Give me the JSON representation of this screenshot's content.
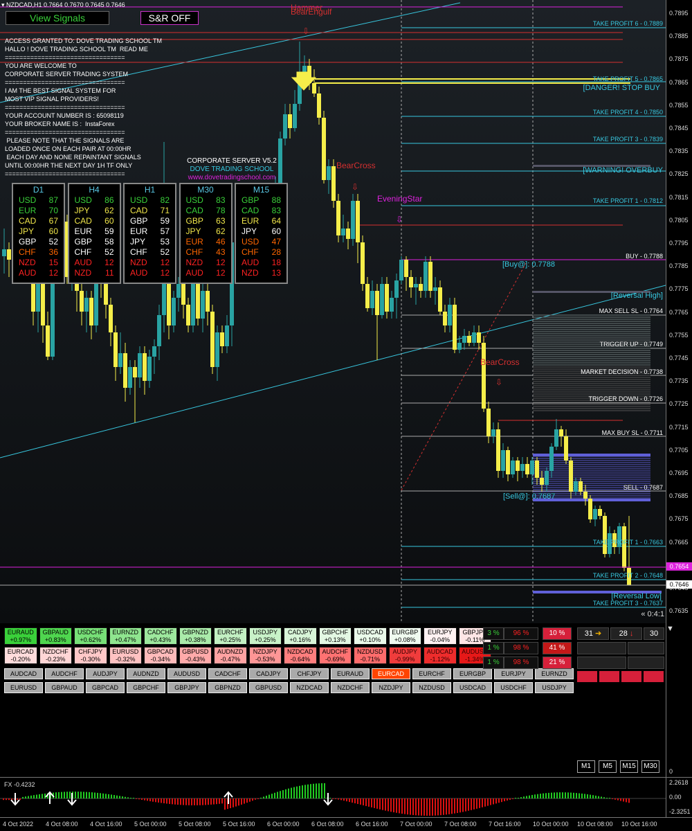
{
  "header": {
    "symbol_info": "NZDCAD,H1  0.7664 0.7670 0.7645 0.7646",
    "view_signals_label": "View Signals",
    "sr_label": "S&R OFF"
  },
  "messages": [
    "ACCESS GRANTED TO: DOVE TRADING SCHOOL TM",
    "HALLO ! DOVE TRADING SCHOOL TM  READ ME",
    "=================================",
    "YOU ARE WELCOME TO",
    "CORPORATE SERVER TRADING SYSTEM",
    "=================================",
    "I AM THE BEST SIGNAL SYSTEM FOR",
    "MOST VIP SIGNAL PROVIDERS!",
    "=================================",
    "YOUR ACCOUNT NUMBER IS : 65098119",
    "YOUR BROKER NAME IS :  InstaForex",
    "=================================",
    " PLEASE NOTE THAT THE SIGNALS ARE",
    "LOADED ONCE ON EACH PAIR AT 00:00HR",
    " EACH DAY AND NONE REPAINTANT SIGNALS",
    "UNTIL 00:00HR THE NEXT DAY 1H TF ONLY",
    "================================="
  ],
  "server": {
    "line1": "CORPORATE SERVER V5.2",
    "line2": "DOVE TRADING SCHOOL",
    "line3": "www.dovetradingschool.com"
  },
  "strength_panels": [
    {
      "title": "D1",
      "rows": [
        [
          "USD",
          "87",
          "#3ad13a"
        ],
        [
          "EUR",
          "70",
          "#3ad13a"
        ],
        [
          "CAD",
          "67",
          "#f0e64a"
        ],
        [
          "JPY",
          "60",
          "#f0e64a"
        ],
        [
          "GBP",
          "52",
          "#ffffff"
        ],
        [
          "CHF",
          "36",
          "#ff6600"
        ],
        [
          "NZD",
          "15",
          "#ff2222"
        ],
        [
          "AUD",
          "12",
          "#ff2222"
        ]
      ]
    },
    {
      "title": "H4",
      "rows": [
        [
          "USD",
          "86",
          "#3ad13a"
        ],
        [
          "JPY",
          "62",
          "#f0e64a"
        ],
        [
          "CAD",
          "60",
          "#f0e64a"
        ],
        [
          "EUR",
          "59",
          "#ffffff"
        ],
        [
          "GBP",
          "58",
          "#ffffff"
        ],
        [
          "CHF",
          "52",
          "#ffffff"
        ],
        [
          "AUD",
          "12",
          "#ff2222"
        ],
        [
          "NZD",
          "11",
          "#ff2222"
        ]
      ]
    },
    {
      "title": "H1",
      "rows": [
        [
          "USD",
          "82",
          "#3ad13a"
        ],
        [
          "CAD",
          "71",
          "#f0e64a"
        ],
        [
          "GBP",
          "59",
          "#ffffff"
        ],
        [
          "EUR",
          "57",
          "#ffffff"
        ],
        [
          "JPY",
          "53",
          "#ffffff"
        ],
        [
          "CHF",
          "52",
          "#ffffff"
        ],
        [
          "NZD",
          "12",
          "#ff2222"
        ],
        [
          "AUD",
          "12",
          "#ff2222"
        ]
      ]
    },
    {
      "title": "M30",
      "rows": [
        [
          "USD",
          "83",
          "#3ad13a"
        ],
        [
          "CAD",
          "78",
          "#3ad13a"
        ],
        [
          "GBP",
          "63",
          "#f0e64a"
        ],
        [
          "JPY",
          "62",
          "#f0e64a"
        ],
        [
          "EUR",
          "46",
          "#ff6600"
        ],
        [
          "CHF",
          "43",
          "#ff6600"
        ],
        [
          "NZD",
          "12",
          "#ff2222"
        ],
        [
          "AUD",
          "12",
          "#ff2222"
        ]
      ]
    },
    {
      "title": "M15",
      "rows": [
        [
          "GBP",
          "88",
          "#3ad13a"
        ],
        [
          "CAD",
          "83",
          "#3ad13a"
        ],
        [
          "EUR",
          "64",
          "#f0e64a"
        ],
        [
          "JPY",
          "60",
          "#ffffff"
        ],
        [
          "USD",
          "47",
          "#ff6600"
        ],
        [
          "CHF",
          "28",
          "#ff6600"
        ],
        [
          "AUD",
          "18",
          "#ff2222"
        ],
        [
          "NZD",
          "13",
          "#ff2222"
        ]
      ]
    }
  ],
  "patterns": {
    "hammer": "Hammer",
    "bearish_engulf": "BearEngulf",
    "bearcross1": "BearCross",
    "eveningstar": "EveningStar",
    "bearcross2": "BearCross"
  },
  "levels": {
    "tp6": "TAKE PROFIT 6  -  0.7889",
    "tp5": "TAKE PROFIT 5  -  0.7865",
    "danger": "[DANGER! STOP BUY",
    "tp4": "TAKE PROFIT 4  -  0.7850",
    "tp3": "TAKE PROFIT 3  -  0.7839",
    "warning": "[WARNING! OVERBUY",
    "tp1": "TAKE PROFIT 1  -  0.7812",
    "buy": "BUY  -  0.7788",
    "buy_at": "[Buy@]: 0.7788",
    "rev_high": "[Reversal High]",
    "max_sell_sl": "MAX SELL SL  -  0.7764",
    "trigger_up": "TRIGGER UP  -  0.7749",
    "market_decision": "MARKET DECISION  -  0.7738",
    "trigger_down": "TRIGGER DOWN  -  0.7726",
    "max_buy_sl": "MAX BUY SL  -  0.7711",
    "sell": "SELL  -  0.7687",
    "sell_at": "[Sell@]: 0.7687",
    "stp1": "TAKE PROFIT 1  -  0.7663",
    "stp2": "TAKE PROFIT 2  -  0.7648",
    "rev_low": "[Reversal Low]",
    "stp3": "TAKE PROFIT 3  -  0.7637",
    "countdown": "« 0:4:1"
  },
  "price_axis": [
    "0.7895",
    "0.7885",
    "0.7875",
    "0.7865",
    "0.7855",
    "0.7845",
    "0.7835",
    "0.7825",
    "0.7815",
    "0.7805",
    "0.7795",
    "0.7785",
    "0.7775",
    "0.7765",
    "0.7755",
    "0.7745",
    "0.7735",
    "0.7725",
    "0.7715",
    "0.7705",
    "0.7695",
    "0.7685",
    "0.7675",
    "0.7665",
    "0.7655",
    "0.7645",
    "0.7635"
  ],
  "price_tags": {
    "tag1": "0.7654",
    "tag2": "0.7646"
  },
  "tiles": [
    [
      "EURAUD",
      "+0.97%",
      "#3ad13a"
    ],
    [
      "GBPAUD",
      "+0.83%",
      "#4fd64f"
    ],
    [
      "USDCHF",
      "+0.62%",
      "#77e077"
    ],
    [
      "EURNZD",
      "+0.47%",
      "#8fe58f"
    ],
    [
      "CADCHF",
      "+0.43%",
      "#9de89d"
    ],
    [
      "GBPNZD",
      "+0.38%",
      "#aaebaa"
    ],
    [
      "EURCHF",
      "+0.25%",
      "#c2f0c2"
    ],
    [
      "USDJPY",
      "+0.25%",
      "#c8f2c8"
    ],
    [
      "CADJPY",
      "+0.16%",
      "#d8f5d8"
    ],
    [
      "GBPCHF",
      "+0.13%",
      "#e3f8e3"
    ],
    [
      "USDCAD",
      "+0.10%",
      "#eafaea"
    ],
    [
      "EURGBP",
      "+0.08%",
      "#f0fbf0"
    ],
    [
      "EURJPY",
      "-0.04%",
      "#fff2f2"
    ],
    [
      "GBPJPY",
      "-0.11%",
      "#ffe6e6"
    ],
    [
      "EURCAD",
      "-0.20%",
      "#ffdcdc"
    ],
    [
      "NZDCHF",
      "-0.23%",
      "#ffd6d6"
    ],
    [
      "CHFJPY",
      "-0.30%",
      "#ffc8c8"
    ],
    [
      "EURUSD",
      "-0.32%",
      "#ffc2c2"
    ],
    [
      "GBPCAD",
      "-0.34%",
      "#ffbbbb"
    ],
    [
      "GBPUSD",
      "-0.43%",
      "#ffaaaa"
    ],
    [
      "AUDNZD",
      "-0.47%",
      "#ffa2a2"
    ],
    [
      "NZDJPY",
      "-0.53%",
      "#ff9696"
    ],
    [
      "NZDCAD",
      "-0.64%",
      "#ff7e7e"
    ],
    [
      "AUDCHF",
      "-0.69%",
      "#ff7272"
    ],
    [
      "NZDUSD",
      "-0.71%",
      "#ff6c6c"
    ],
    [
      "AUDJPY",
      "-0.99%",
      "#f03c3c"
    ],
    [
      "AUDCAD",
      "-1.12%",
      "#ee2c2c"
    ],
    [
      "AUDUSD",
      "-1.34%",
      "#e61818"
    ]
  ],
  "pair_buttons_row1": [
    "AUDCAD",
    "AUDCHF",
    "AUDJPY",
    "AUDNZD",
    "AUDUSD",
    "CADCHF",
    "CADJPY",
    "CHFJPY",
    "EURAUD",
    "EURCAD",
    "EURCHF",
    "EURGBP",
    "EURJPY",
    "EURNZD"
  ],
  "pair_buttons_row2": [
    "EURUSD",
    "GBPAUD",
    "GBPCAD",
    "GBPCHF",
    "GBPJPY",
    "GBPNZD",
    "GBPUSD",
    "NZDCAD",
    "NZDCHF",
    "NZDJPY",
    "NZDUSD",
    "USDCAD",
    "USDCHF",
    "USDJPY"
  ],
  "active_pair": "EURCAD",
  "stats": [
    {
      "a": "3 %",
      "b": "96 %",
      "c": "10 %"
    },
    {
      "a": "1 %",
      "b": "98 %",
      "c": "41 %"
    },
    {
      "a": "1 %",
      "b": "98 %",
      "c": "21 %"
    }
  ],
  "counters": {
    "n1": "31",
    "n2": "28",
    "n3": "30"
  },
  "bottom_axis_zero": "0",
  "timeframes": [
    "M1",
    "M5",
    "M15",
    "M30"
  ],
  "oscillator": {
    "label": "FX -0.4232",
    "max": "2.2618",
    "zero": "0.00",
    "min": "-2.3251"
  },
  "time_axis": [
    "4 Oct 2022",
    "4 Oct 08:00",
    "4 Oct 16:00",
    "5 Oct 00:00",
    "5 Oct 08:00",
    "5 Oct 16:00",
    "6 Oct 00:00",
    "6 Oct 08:00",
    "6 Oct 16:00",
    "7 Oct 00:00",
    "7 Oct 08:00",
    "7 Oct 16:00",
    "10 Oct 00:00",
    "10 Oct 08:00",
    "10 Oct 16:00"
  ],
  "colors": {
    "bull": "#29a3a3",
    "bear": "#f5ee4a",
    "cyan": "#38c8e0",
    "red": "#d63030",
    "magenta": "#dd22dd",
    "violet": "#6060d8"
  }
}
